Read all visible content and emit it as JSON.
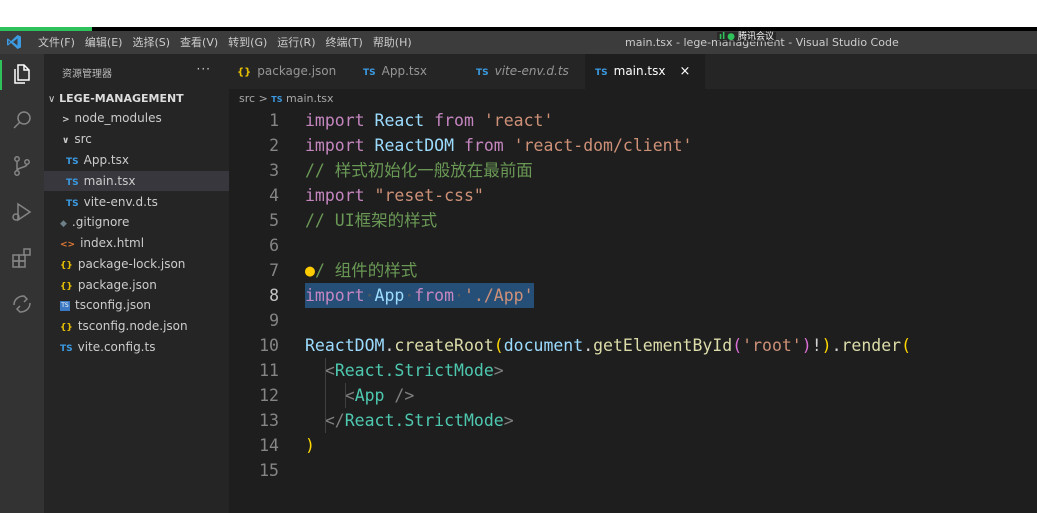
{
  "titlebar": {
    "menu": [
      "文件(F)",
      "编辑(E)",
      "选择(S)",
      "查看(V)",
      "转到(G)",
      "运行(R)",
      "终端(T)",
      "帮助(H)"
    ],
    "window_title": "main.tsx - lege-management - Visual Studio Code",
    "meeting_label": "腾讯会议"
  },
  "activitybar": {
    "icons": [
      "explorer-icon",
      "search-icon",
      "source-control-icon",
      "run-debug-icon",
      "extensions-icon",
      "remote-icon"
    ]
  },
  "sidebar": {
    "header": "资源管理器",
    "more": "···",
    "root": "LEGE-MANAGEMENT",
    "items": [
      {
        "label": "node_modules",
        "icon": ">",
        "kind": "folder"
      },
      {
        "label": "src",
        "icon": "∨",
        "kind": "folder-open"
      },
      {
        "label": "App.tsx",
        "icon": "TS",
        "kind": "ts"
      },
      {
        "label": "main.tsx",
        "icon": "TS",
        "kind": "ts"
      },
      {
        "label": "vite-env.d.ts",
        "icon": "TS",
        "kind": "ts"
      },
      {
        "label": ".gitignore",
        "icon": "◆",
        "kind": "git"
      },
      {
        "label": "index.html",
        "icon": "<>",
        "kind": "html"
      },
      {
        "label": "package-lock.json",
        "icon": "{}",
        "kind": "json"
      },
      {
        "label": "package.json",
        "icon": "{}",
        "kind": "json"
      },
      {
        "label": "tsconfig.json",
        "icon": "TS",
        "kind": "tsconfig"
      },
      {
        "label": "tsconfig.node.json",
        "icon": "{}",
        "kind": "json"
      },
      {
        "label": "vite.config.ts",
        "icon": "TS",
        "kind": "ts"
      }
    ]
  },
  "tabs": [
    {
      "label": "package.json",
      "icon": "{}"
    },
    {
      "label": "App.tsx",
      "icon": "TS"
    },
    {
      "label": "vite-env.d.ts",
      "icon": "TS"
    },
    {
      "label": "main.tsx",
      "icon": "TS",
      "close": "×"
    }
  ],
  "breadcrumb": {
    "folder": "src",
    "sep": ">",
    "icon": "TS",
    "file": "main.tsx"
  },
  "code": {
    "line_numbers": [
      "1",
      "2",
      "3",
      "4",
      "5",
      "6",
      "7",
      "8",
      "9",
      "10",
      "11",
      "12",
      "13",
      "14",
      "15"
    ],
    "l1": {
      "kw": "import",
      "id": "React",
      "from": "from",
      "str": "'react'"
    },
    "l2": {
      "kw": "import",
      "id": "ReactDOM",
      "from": "from",
      "str": "'react-dom/client'"
    },
    "l3": {
      "cm": "// 样式初始化一般放在最前面"
    },
    "l4": {
      "kw": "import",
      "str": "\"reset-css\""
    },
    "l5": {
      "cm": "// UI框架的样式"
    },
    "l7": {
      "cm": "/ 组件的样式"
    },
    "l8": {
      "kw": "import",
      "id": "App",
      "from": "from",
      "str": "'./App'"
    },
    "l10": {
      "obj": "ReactDOM",
      "m1": "createRoot",
      "arg_obj": "document",
      "m2": "getElementById",
      "str": "'root'",
      "bang": "!",
      "m3": "render"
    },
    "l11": {
      "tag": "React.StrictMode"
    },
    "l12": {
      "tag": "App"
    },
    "l13": {
      "tag": "React.StrictMode"
    }
  }
}
